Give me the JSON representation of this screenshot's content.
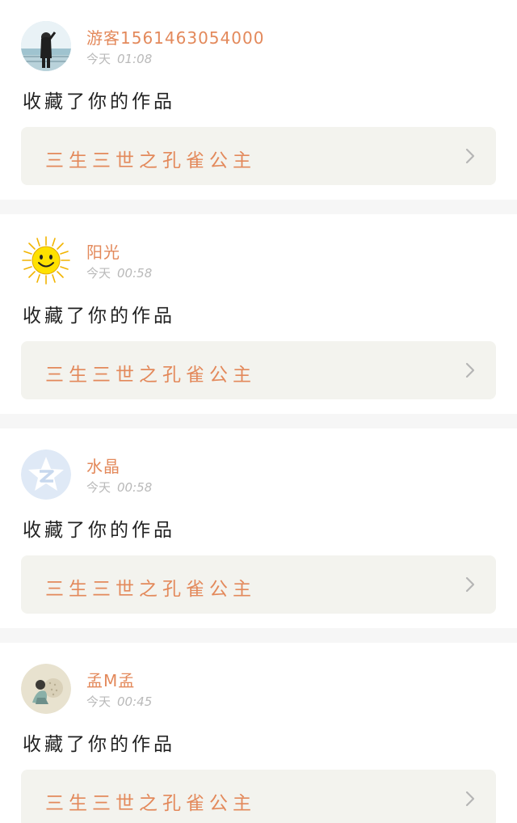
{
  "notifications": [
    {
      "username": "游客1561463054000",
      "day": "今天",
      "time": "01:08",
      "action": "收藏了你的作品",
      "work_title": "三生三世之孔雀公主",
      "avatar_icon": "girl-at-seaside-photo"
    },
    {
      "username": "阳光",
      "day": "今天",
      "time": "00:58",
      "action": "收藏了你的作品",
      "work_title": "三生三世之孔雀公主",
      "avatar_icon": "smiling-sun-icon"
    },
    {
      "username": "水晶",
      "day": "今天",
      "time": "00:58",
      "action": "收藏了你的作品",
      "work_title": "三生三世之孔雀公主",
      "avatar_icon": "default-qzone-avatar-icon"
    },
    {
      "username": "孟M孟",
      "day": "今天",
      "time": "00:45",
      "action": "收藏了你的作品",
      "work_title": "三生三世之孔雀公主",
      "avatar_icon": "illustrated-girl-avatar"
    }
  ],
  "colors": {
    "accent": "#e3895b",
    "muted_text": "#b9b9b9",
    "primary_text": "#222222",
    "card_link_bg": "#f3f3ee",
    "page_bg": "#f6f6f6"
  }
}
